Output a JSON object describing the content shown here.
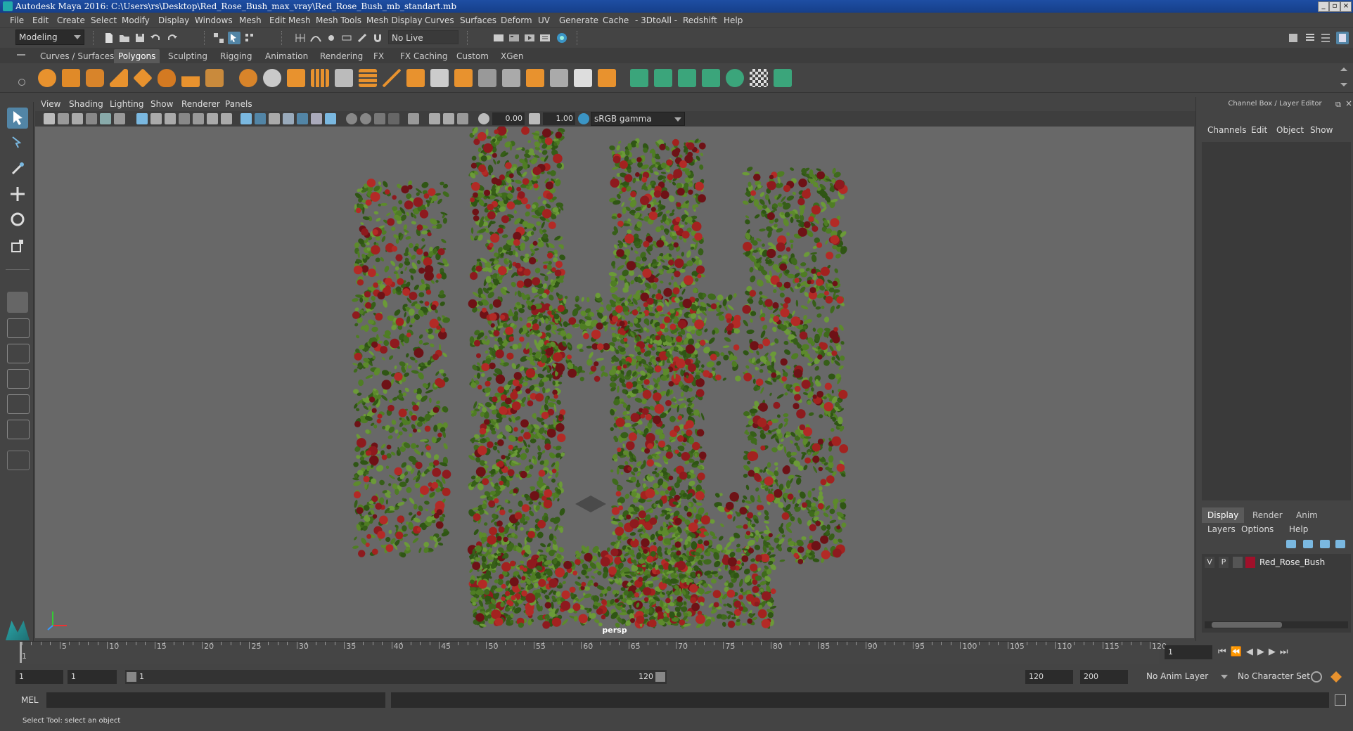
{
  "window": {
    "title": "Autodesk Maya 2016: C:\\Users\\rs\\Desktop\\Red_Rose_Bush_max_vray\\Red_Rose_Bush_mb_standart.mb",
    "minimize": "_",
    "maximize": "▫",
    "close": "×"
  },
  "menu": [
    "File",
    "Edit",
    "Create",
    "Select",
    "Modify",
    "Display",
    "Windows",
    "Mesh",
    "Edit Mesh",
    "Mesh Tools",
    "Mesh Display",
    "Curves",
    "Surfaces",
    "Deform",
    "UV",
    "Generate",
    "Cache",
    "- 3DtoAll -",
    "Redshift",
    "Help"
  ],
  "statusline": {
    "mode": "Modeling",
    "live_surface": "No Live Surface"
  },
  "shelf": {
    "tabs": [
      "Curves / Surfaces",
      "Polygons",
      "Sculpting",
      "Rigging",
      "Animation",
      "Rendering",
      "FX",
      "FX Caching",
      "Custom",
      "XGen"
    ],
    "active_tab": "Polygons"
  },
  "viewport": {
    "menu": [
      "View",
      "Shading",
      "Lighting",
      "Show",
      "Renderer",
      "Panels"
    ],
    "exposure": "0.00",
    "gamma": "1.00",
    "color_space": "sRGB gamma",
    "camera_label": "persp"
  },
  "channel_box": {
    "title": "Channel Box / Layer Editor",
    "menu": [
      "Channels",
      "Edit",
      "Object",
      "Show"
    ]
  },
  "layer_editor": {
    "tabs": [
      "Display",
      "Render",
      "Anim"
    ],
    "active_tab": "Display",
    "menu": [
      "Layers",
      "Options",
      "Help"
    ],
    "layers": [
      {
        "v": "V",
        "p": "P",
        "name": "Red_Rose_Bush",
        "color": "#a0102a"
      }
    ]
  },
  "timeline": {
    "ticks": [
      "5",
      "10",
      "15",
      "20",
      "25",
      "30",
      "35",
      "40",
      "45",
      "50",
      "55",
      "60",
      "65",
      "70",
      "75",
      "80",
      "85",
      "90",
      "95",
      "100",
      "105",
      "110",
      "115",
      "120"
    ],
    "start_mark": "1",
    "current_frame": "1"
  },
  "range": {
    "start": "1",
    "playback_start": "1",
    "slider_start": "1",
    "slider_end": "120",
    "playback_end": "120",
    "end": "200",
    "anim_layer": "No Anim Layer",
    "character_set": "No Character Set"
  },
  "command_line": {
    "label": "MEL"
  },
  "status": {
    "help_text": "Select Tool: select an object"
  },
  "colors": {
    "accent": "#5285a6",
    "title_bar": "#1e4ea3",
    "rose_red": "#8e1a1e",
    "leaf_green": "#3f6a1c"
  }
}
